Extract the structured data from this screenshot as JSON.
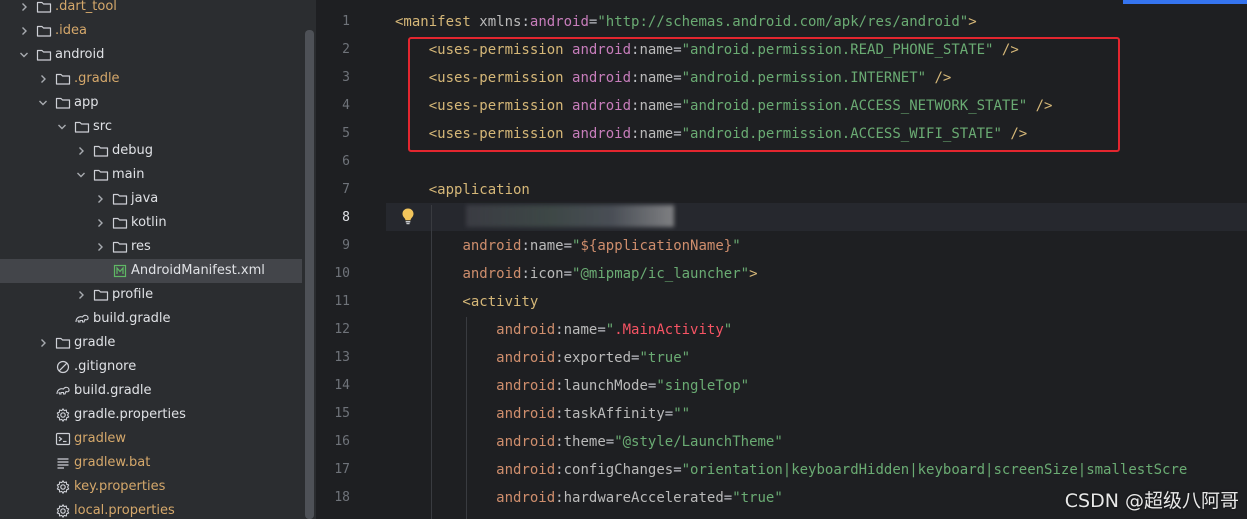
{
  "project_tree": {
    "items": [
      {
        "label": ".dart_tool",
        "icon": "folder-icon",
        "expanded": false,
        "color": "orange"
      },
      {
        "label": ".idea",
        "icon": "folder-idea-icon",
        "expanded": false,
        "color": "orange"
      },
      {
        "label": "android",
        "icon": "folder-icon",
        "expanded": true,
        "color": "plain"
      },
      {
        "label": ".gradle",
        "icon": "folder-icon",
        "expanded": false,
        "color": "orange"
      },
      {
        "label": "app",
        "icon": "folder-icon",
        "expanded": true,
        "color": "plain"
      },
      {
        "label": "src",
        "icon": "folder-icon",
        "expanded": true,
        "color": "plain"
      },
      {
        "label": "debug",
        "icon": "folder-icon",
        "expanded": false,
        "color": "plain"
      },
      {
        "label": "main",
        "icon": "folder-icon",
        "expanded": true,
        "color": "plain"
      },
      {
        "label": "java",
        "icon": "folder-icon",
        "expanded": false,
        "color": "plain"
      },
      {
        "label": "kotlin",
        "icon": "folder-icon",
        "expanded": false,
        "color": "plain"
      },
      {
        "label": "res",
        "icon": "folder-icon",
        "expanded": false,
        "color": "plain"
      },
      {
        "label": "AndroidManifest.xml",
        "icon": "manifest-file-icon",
        "expanded": null,
        "color": "plain",
        "selected": true
      },
      {
        "label": "profile",
        "icon": "folder-icon",
        "expanded": false,
        "color": "plain"
      },
      {
        "label": "build.gradle",
        "icon": "gradle-file-icon",
        "expanded": null,
        "color": "plain"
      },
      {
        "label": "gradle",
        "icon": "folder-icon",
        "expanded": false,
        "color": "plain"
      },
      {
        "label": ".gitignore",
        "icon": "ignore-file-icon",
        "expanded": null,
        "color": "plain"
      },
      {
        "label": "build.gradle",
        "icon": "gradle-file-icon",
        "expanded": null,
        "color": "plain"
      },
      {
        "label": "gradle.properties",
        "icon": "settings-file-icon",
        "expanded": null,
        "color": "plain"
      },
      {
        "label": "gradlew",
        "icon": "terminal-file-icon",
        "expanded": null,
        "color": "orange"
      },
      {
        "label": "gradlew.bat",
        "icon": "text-file-icon",
        "expanded": null,
        "color": "orange"
      },
      {
        "label": "key.properties",
        "icon": "settings-file-icon",
        "expanded": null,
        "color": "orange"
      },
      {
        "label": "local.properties",
        "icon": "settings-file-icon",
        "expanded": null,
        "color": "orange"
      }
    ]
  },
  "editor": {
    "file": "AndroidManifest.xml",
    "current_line": 8,
    "line_numbers": [
      "1",
      "2",
      "3",
      "4",
      "5",
      "6",
      "7",
      "8",
      "9",
      "10",
      "11",
      "12",
      "13",
      "14",
      "15",
      "16",
      "17",
      "18"
    ],
    "lines": [
      [
        [
          "tk-tag",
          "<manifest "
        ],
        [
          "tk-attr",
          "xmlns"
        ],
        [
          "tk-punct",
          ":"
        ],
        [
          "tk-ns",
          "android"
        ],
        [
          "tk-punct",
          "="
        ],
        [
          "tk-val",
          "\"http://schemas.android.com/apk/res/android\""
        ],
        [
          "tk-tag",
          ">"
        ]
      ],
      [
        [
          "tk-tag",
          "    <uses-permission "
        ],
        [
          "tk-ns",
          "android"
        ],
        [
          "tk-punct",
          ":"
        ],
        [
          "tk-attr",
          "name"
        ],
        [
          "tk-punct",
          "="
        ],
        [
          "tk-val",
          "\"android.permission.READ_PHONE_STATE\""
        ],
        [
          "tk-tag",
          " />"
        ]
      ],
      [
        [
          "tk-tag",
          "    <uses-permission "
        ],
        [
          "tk-ns",
          "android"
        ],
        [
          "tk-punct",
          ":"
        ],
        [
          "tk-attr",
          "name"
        ],
        [
          "tk-punct",
          "="
        ],
        [
          "tk-val",
          "\"android.permission.INTERNET\""
        ],
        [
          "tk-tag",
          " />"
        ]
      ],
      [
        [
          "tk-tag",
          "    <uses-permission "
        ],
        [
          "tk-ns",
          "android"
        ],
        [
          "tk-punct",
          ":"
        ],
        [
          "tk-attr",
          "name"
        ],
        [
          "tk-punct",
          "="
        ],
        [
          "tk-val",
          "\"android.permission.ACCESS_NETWORK_STATE\""
        ],
        [
          "tk-tag",
          " />"
        ]
      ],
      [
        [
          "tk-tag",
          "    <uses-permission "
        ],
        [
          "tk-ns",
          "android"
        ],
        [
          "tk-punct",
          ":"
        ],
        [
          "tk-attr",
          "name"
        ],
        [
          "tk-punct",
          "="
        ],
        [
          "tk-val",
          "\"android.permission.ACCESS_WIFI_STATE\""
        ],
        [
          "tk-tag",
          " />"
        ]
      ],
      [],
      [
        [
          "tk-tag",
          "    <application"
        ]
      ],
      [],
      [
        [
          "tk-punct",
          "        "
        ],
        [
          "tk-nsr",
          "android"
        ],
        [
          "tk-punct",
          ":"
        ],
        [
          "tk-attr",
          "name"
        ],
        [
          "tk-punct",
          "="
        ],
        [
          "tk-val",
          "\""
        ],
        [
          "tk-ref",
          "${applicationName}"
        ],
        [
          "tk-val",
          "\""
        ]
      ],
      [
        [
          "tk-punct",
          "        "
        ],
        [
          "tk-nsr",
          "android"
        ],
        [
          "tk-punct",
          ":"
        ],
        [
          "tk-attr",
          "icon"
        ],
        [
          "tk-punct",
          "="
        ],
        [
          "tk-val",
          "\"@mipmap/ic_launcher\""
        ],
        [
          "tk-tag",
          ">"
        ]
      ],
      [
        [
          "tk-tag",
          "        <activity"
        ]
      ],
      [
        [
          "tk-punct",
          "            "
        ],
        [
          "tk-nsr",
          "android"
        ],
        [
          "tk-punct",
          ":"
        ],
        [
          "tk-attr",
          "name"
        ],
        [
          "tk-punct",
          "="
        ],
        [
          "tk-val",
          "\""
        ],
        [
          "tk-red",
          ".MainActivity"
        ],
        [
          "tk-val",
          "\""
        ]
      ],
      [
        [
          "tk-punct",
          "            "
        ],
        [
          "tk-nsr",
          "android"
        ],
        [
          "tk-punct",
          ":"
        ],
        [
          "tk-attr",
          "exported"
        ],
        [
          "tk-punct",
          "="
        ],
        [
          "tk-val",
          "\"true\""
        ]
      ],
      [
        [
          "tk-punct",
          "            "
        ],
        [
          "tk-nsr",
          "android"
        ],
        [
          "tk-punct",
          ":"
        ],
        [
          "tk-attr",
          "launchMode"
        ],
        [
          "tk-punct",
          "="
        ],
        [
          "tk-val",
          "\"singleTop\""
        ]
      ],
      [
        [
          "tk-punct",
          "            "
        ],
        [
          "tk-nsr",
          "android"
        ],
        [
          "tk-punct",
          ":"
        ],
        [
          "tk-attr",
          "taskAffinity"
        ],
        [
          "tk-punct",
          "="
        ],
        [
          "tk-val",
          "\"\""
        ]
      ],
      [
        [
          "tk-punct",
          "            "
        ],
        [
          "tk-nsr",
          "android"
        ],
        [
          "tk-punct",
          ":"
        ],
        [
          "tk-attr",
          "theme"
        ],
        [
          "tk-punct",
          "="
        ],
        [
          "tk-val",
          "\"@style/LaunchTheme\""
        ]
      ],
      [
        [
          "tk-punct",
          "            "
        ],
        [
          "tk-nsr",
          "android"
        ],
        [
          "tk-punct",
          ":"
        ],
        [
          "tk-attr",
          "configChanges"
        ],
        [
          "tk-punct",
          "="
        ],
        [
          "tk-val",
          "\"orientation|keyboardHidden|keyboard|screenSize|smallestScre"
        ]
      ],
      [
        [
          "tk-punct",
          "            "
        ],
        [
          "tk-nsr",
          "android"
        ],
        [
          "tk-punct",
          ":"
        ],
        [
          "tk-attr",
          "hardwareAccelerated"
        ],
        [
          "tk-punct",
          "="
        ],
        [
          "tk-val",
          "\"true\""
        ]
      ]
    ]
  },
  "colors": {
    "highlight_box": "#e3262f",
    "accent": "#3574f0"
  },
  "watermark": "CSDN @超级八阿哥"
}
